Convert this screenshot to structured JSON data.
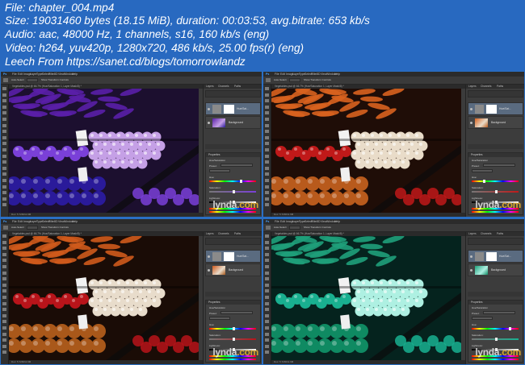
{
  "header": {
    "lines": [
      "File: chapter_004.mp4",
      "Size: 19031460 bytes (18.15 MiB), duration: 00:03:53, avg.bitrate: 653 kb/s",
      "Audio: aac, 48000 Hz, 1 channels, s16, 160 kb/s (eng)",
      "Video: h264, yuv420p, 1280x720, 486 kb/s, 25.00 fps(r) (eng)",
      "Leech From https://sanet.cd/blogs/tomorrowlandz"
    ]
  },
  "app": {
    "logo": "Ps",
    "menu": [
      "File",
      "Edit",
      "Image",
      "Layer",
      "Type",
      "Select",
      "Filter",
      "3D",
      "View",
      "Window",
      "Help"
    ],
    "options": {
      "auto_select": "Auto-Select:",
      "show_transform": "Show Transform Controls"
    }
  },
  "panels": [
    {
      "id": "purple",
      "doc_tab": "Vegetables.psd @ 66.7% (Hue/Saturation 1, Layer Mask/8) *",
      "status": "Doc: 5.72M/11.9M",
      "watermark": {
        "prefix": "lynda",
        "suffix": ".com"
      },
      "palette": {
        "bg": "#1c0f2f",
        "top": "#5a1fa8",
        "mid": "#c5a0e6",
        "low": "#2a1a9a",
        "accent": "#7a40d8"
      }
    },
    {
      "id": "orange",
      "doc_tab": "Vegetables.psd @ 66.7% (Hue/Saturation 1, Layer Mask/8) *",
      "status": "Doc: 5.72M/11.9M",
      "watermark": {
        "prefix": "lynda",
        "suffix": ".com"
      },
      "palette": {
        "bg": "#1f0d07",
        "top": "#d8621f",
        "mid": "#e9dcc9",
        "low": "#b85a1c",
        "accent": "#c01919"
      }
    },
    {
      "id": "natural",
      "doc_tab": "Vegetables.psd @ 66.7% (Hue/Saturation 1, Layer Mask/8) *",
      "status": "Doc: 5.72M/11.9M",
      "watermark": {
        "prefix": "lynda",
        "suffix": ".com"
      },
      "palette": {
        "bg": "#1a0c06",
        "top": "#cf5a1c",
        "mid": "#e8dccb",
        "low": "#a9581a",
        "accent": "#b8141a"
      }
    },
    {
      "id": "teal",
      "doc_tab": "Vegetables.psd @ 66.7% (Hue/Saturation 1, Layer Mask/8) *",
      "status": "Doc: 5.72M/11.9M",
      "watermark": {
        "prefix": "lynda",
        "suffix": ".com"
      },
      "palette": {
        "bg": "#05231e",
        "top": "#1fa07a",
        "mid": "#aef0e2",
        "low": "#0f8a62",
        "accent": "#19b090"
      }
    }
  ],
  "layers_panel": {
    "tabs": [
      "Layers",
      "Channels",
      "Paths"
    ],
    "adjustment_layer": "Hue/Sat...",
    "background_layer": "Background",
    "properties_title": "Properties",
    "properties_sub": "Hue/Saturation",
    "preset_label": "Preset:",
    "preset_value": "Custom",
    "channel_value": "Master",
    "hue_label": "Hue:",
    "saturation_label": "Saturation:",
    "lightness_label": "Lightness:"
  }
}
